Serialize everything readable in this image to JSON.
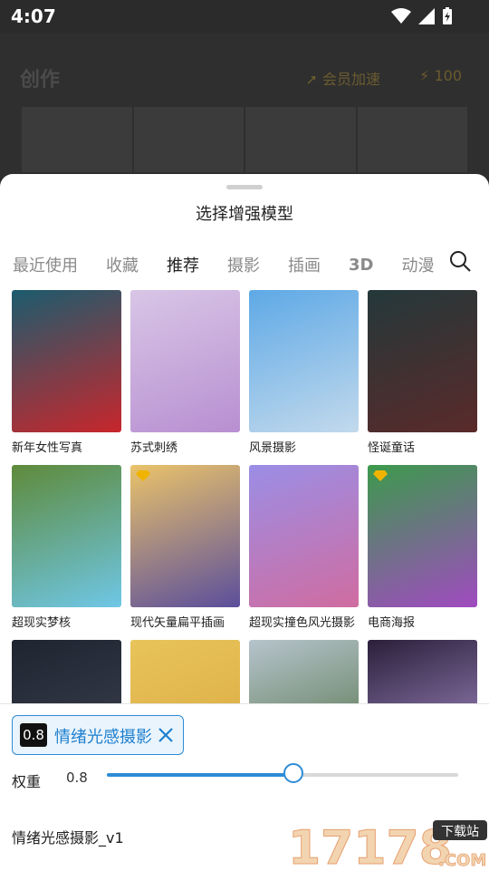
{
  "status_bar": {
    "time": "4:07"
  },
  "background": {
    "title": "创作",
    "vip_label": "会员加速",
    "credits": "100"
  },
  "sheet": {
    "title": "选择增强模型",
    "tabs": [
      "最近使用",
      "收藏",
      "推荐",
      "摄影",
      "插画",
      "3D",
      "动漫"
    ],
    "active_tab": "推荐",
    "models": [
      {
        "label": "新年女性写真",
        "colors": [
          "#1b5c6e",
          "#c8262c"
        ]
      },
      {
        "label": "苏式刺绣",
        "colors": [
          "#d8c6e6",
          "#b88fd1"
        ]
      },
      {
        "label": "风景摄影",
        "colors": [
          "#5ea9e6",
          "#c2d9ec"
        ]
      },
      {
        "label": "怪诞童话",
        "colors": [
          "#24383a",
          "#5a2a2a"
        ]
      },
      {
        "label": "超现实梦核",
        "colors": [
          "#5e8a3a",
          "#6fc7e6"
        ]
      },
      {
        "label": "现代矢量扁平插画",
        "colors": [
          "#eac36a",
          "#5b4e9b"
        ]
      },
      {
        "label": "超现实撞色风光摄影",
        "colors": [
          "#9b8ee6",
          "#d06ca0"
        ]
      },
      {
        "label": "电商海报",
        "colors": [
          "#3c9a4c",
          "#a04ac0"
        ]
      },
      {
        "label": "",
        "colors": [
          "#1e2430",
          "#3e4452"
        ]
      },
      {
        "label": "",
        "colors": [
          "#e8c45a",
          "#d8a740"
        ]
      },
      {
        "label": "",
        "colors": [
          "#b6c4cc",
          "#4a6a3c"
        ]
      },
      {
        "label": "",
        "colors": [
          "#2a1f3a",
          "#b49ad8"
        ]
      }
    ]
  },
  "selection": {
    "weight_badge": "0.8",
    "model": "情绪光感摄影",
    "weight_label": "权重",
    "weight_value": "0.8",
    "weight_fraction": 0.53,
    "model_version": "情绪光感摄影_v1"
  },
  "watermark": {
    "main": "17178",
    "tag": "下载站",
    "suffix": ".COM"
  },
  "colors": {
    "accent": "#2d8cd6",
    "vip_gold": "#f0b400"
  }
}
